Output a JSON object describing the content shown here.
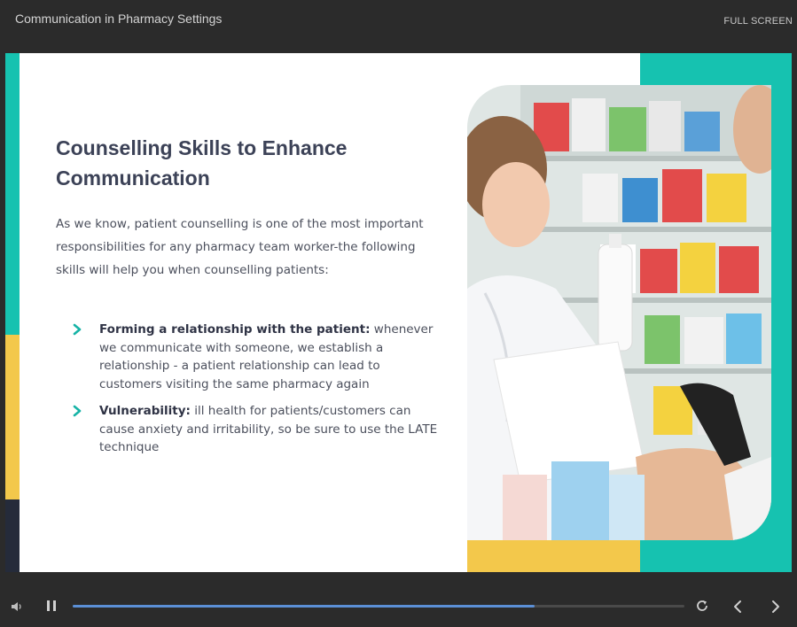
{
  "window": {
    "title": "Communication in Pharmacy Settings",
    "fullscreen_label": "FULL SCREEN"
  },
  "slide": {
    "heading": "Counselling Skills to Enhance Communication",
    "intro": "As we know, patient counselling is one of the most important responsibilities for any pharmacy team worker-the following skills will help you when counselling patients:",
    "bullets": [
      {
        "term": "Forming a relationship with the patient:",
        "text": " whenever we communicate  with someone, we establish a relationship - a patient relationship can lead to customers visiting the same pharmacy again"
      },
      {
        "term": "Vulnerability:",
        "text": " ill health for patients/customers can cause anxiety and irritability, so be sure to use the LATE technique"
      }
    ],
    "image_alt": "Pharmacist smiling and handing a bottle to a customer in a pharmacy",
    "colors": {
      "teal": "#16c2b0",
      "yellow": "#f3c84b",
      "navy": "#252b3a",
      "heading": "#3c4257",
      "chevron": "#16b3a6"
    }
  },
  "player": {
    "progress_fraction": 0.755,
    "icons": [
      "volume-icon",
      "pause-icon",
      "replay-icon",
      "previous-icon",
      "next-icon"
    ]
  }
}
